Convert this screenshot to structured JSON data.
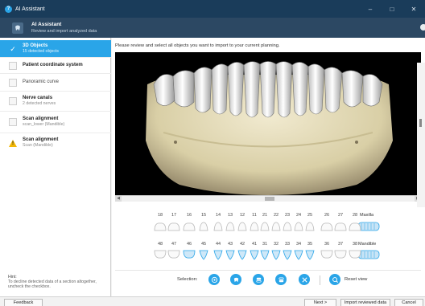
{
  "window": {
    "title": "AI Assistant"
  },
  "header": {
    "title": "AI Assistant",
    "subtitle": "Review and import analyzed data"
  },
  "sidebar": {
    "items": [
      {
        "title": "3D Objects",
        "subtitle": "15 detected objects",
        "state": "active"
      },
      {
        "title": "Patient coordinate system",
        "subtitle": "",
        "state": "checkbox"
      },
      {
        "title": "Panoramic curve",
        "subtitle": "",
        "state": "checkbox"
      },
      {
        "title": "Nerve canals",
        "subtitle": "2 detected nerves",
        "state": "checkbox"
      },
      {
        "title": "Scan alignment",
        "subtitle": "scan_lower (Mandible)",
        "state": "checkbox"
      },
      {
        "title": "Scan alignment",
        "subtitle": "Scan (Mandible)",
        "state": "warning"
      }
    ],
    "hint_title": "Hint:",
    "hint_text": "To decline detected data of a section altogether, uncheck the checkbox."
  },
  "main": {
    "instruction": "Please review and select all objects you want to import to your current planning."
  },
  "tooth_chart": {
    "maxilla_label": "Maxilla",
    "mandible_label": "Mandible",
    "maxilla_teeth": [
      "18",
      "17",
      "16",
      "15",
      "14",
      "13",
      "12",
      "11",
      "21",
      "22",
      "23",
      "24",
      "25",
      "26",
      "27",
      "28"
    ],
    "mandible_teeth": [
      "48",
      "47",
      "46",
      "45",
      "44",
      "43",
      "42",
      "41",
      "31",
      "32",
      "33",
      "34",
      "35",
      "36",
      "37",
      "38"
    ],
    "mandible_selected": [
      false,
      false,
      true,
      true,
      true,
      true,
      true,
      true,
      true,
      true,
      true,
      true,
      true,
      false,
      false,
      false
    ],
    "maxilla_selected": [
      false,
      false,
      false,
      false,
      false,
      false,
      false,
      false,
      false,
      false,
      false,
      false,
      false,
      false,
      false,
      false
    ]
  },
  "toolbar": {
    "selection_label": "Selection:",
    "buttons": [
      "select-all-icon",
      "select-teeth-icon",
      "select-maxilla-icon",
      "select-mandible-icon",
      "deselect-icon"
    ],
    "reset_label": "Reset view"
  },
  "footer": {
    "feedback_label": "Feedback",
    "next_label": "Next >",
    "import_label": "Import reviewed data",
    "cancel_label": "Cancel"
  },
  "colors": {
    "accent": "#2aa5e8",
    "title_bar": "#1a3c5a",
    "header": "#2c4863",
    "bone": "#e8e0bf",
    "tooth": "#f4f4f2"
  }
}
